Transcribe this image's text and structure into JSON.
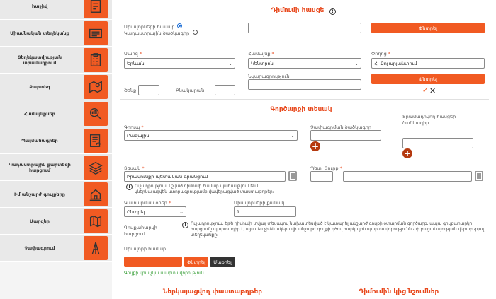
{
  "sidebar": {
    "items": [
      {
        "label": "hաշիվ",
        "icon": "document-icon"
      },
      {
        "label": "Միասնական տեղեկանք",
        "icon": "folder-icon"
      },
      {
        "label": "Տեղեկատվության տրամադրում",
        "icon": "clipboard-icon"
      },
      {
        "label": "Քարտեզ",
        "icon": "map-icon"
      },
      {
        "label": "Համայնքներ",
        "icon": "search-buildings-icon"
      },
      {
        "label": "Պայմանագրեր",
        "icon": "contract-icon"
      },
      {
        "label": "Կադաստրային քարտեզի հարցում",
        "icon": "map-layers-icon"
      },
      {
        "label": "Իմ անշարժ գույքերը",
        "icon": "house-hand-icon"
      },
      {
        "label": "Մարզեր",
        "icon": "regions-icon"
      },
      {
        "label": "Չափագրում",
        "icon": "survey-icon"
      }
    ]
  },
  "address": {
    "title": "Դիմումի հասցե",
    "radio_unit": "Միավորների համար",
    "radio_cadastral": "Կադաստրային ծածկագիր",
    "search_button": "Փնտրել",
    "region_label": "Մարզ",
    "region_value": "Երևան",
    "community_label": "Համայնք",
    "community_value": "Կենտրոն",
    "street_label": "Փողոց",
    "street_value": "Հ. Քոչարյանտում",
    "building_label": "Շենք",
    "apartment_label": "Բնակարան",
    "additional_label": "Նկարագրություն",
    "search_button2": "Փնտրել"
  },
  "transaction": {
    "title": "Գործարքի տեսակ",
    "group_label": "Գրուպ",
    "group_value": "Բազային",
    "cadastral_label": "Չափագրման ծածկագիր",
    "provided_label": "Տրամադրվող հասցեի ծածկագիր",
    "type_label": "Տեսակ",
    "type_value": "Իրավունքի պետական գրանցում",
    "post_code_label": "Պետ. Տուրք",
    "note1": "Ուշադրություն, նշված դիմումի համար պահանջվում են և կներկայացվեն ստորագրությամբ վավերացված փաստաթղթեր։",
    "duration_label": "Կատարման օրեր",
    "duration_value": "Ընտրել",
    "units_label": "Միավորների քանակ",
    "units_value": "1",
    "owners_label": "Գույքահարկի հարցում",
    "note2": "Ուշադրություն, եթե դիմումի տվյալ տեսակով նախատեսված է կատարել անշարժ գույքի օտարման գործարք, ապա գույքահարկի հարցումը պարտադիր է, այսպես չի ձևակերպվի անշարժ գույքի գծով հարկային պարտավորությունների բացակայության վերաբերյալ տեղեկանքը։",
    "unit_number_label": "Միավորի համար",
    "search_button": "Փնտրել",
    "clear_button": "Մաքրել",
    "status_text": "Գույքի վրա չկա պարտավորություն"
  },
  "bottom": {
    "left_title": "Ներկայացվող փաստաթղթեր",
    "right_title": "Դիմումին կից նշումներ"
  },
  "colors": {
    "accent": "#f15a22",
    "title": "#e8491d",
    "status": "#2e9a2e"
  }
}
